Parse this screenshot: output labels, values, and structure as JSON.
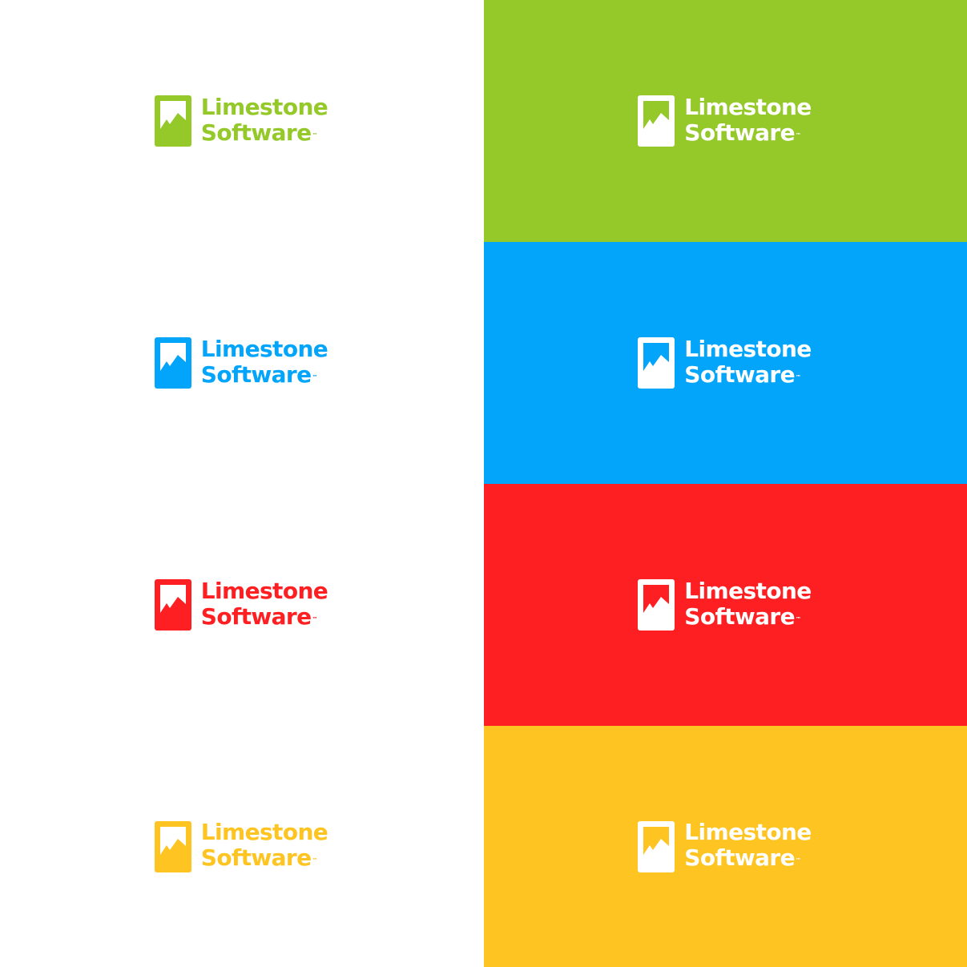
{
  "brand": {
    "line1": "Limestone",
    "line2": "Software",
    "trademark": "™"
  },
  "swatches": [
    {
      "id": "green",
      "color": "#95c92a"
    },
    {
      "id": "blue",
      "color": "#03a5fb"
    },
    {
      "id": "red",
      "color": "#fe1f22"
    },
    {
      "id": "yellow",
      "color": "#fec421"
    }
  ],
  "on_dark_color": "#ffffff",
  "light_background": "#ffffff",
  "icons": {
    "mark": "mountain-frame-icon"
  }
}
